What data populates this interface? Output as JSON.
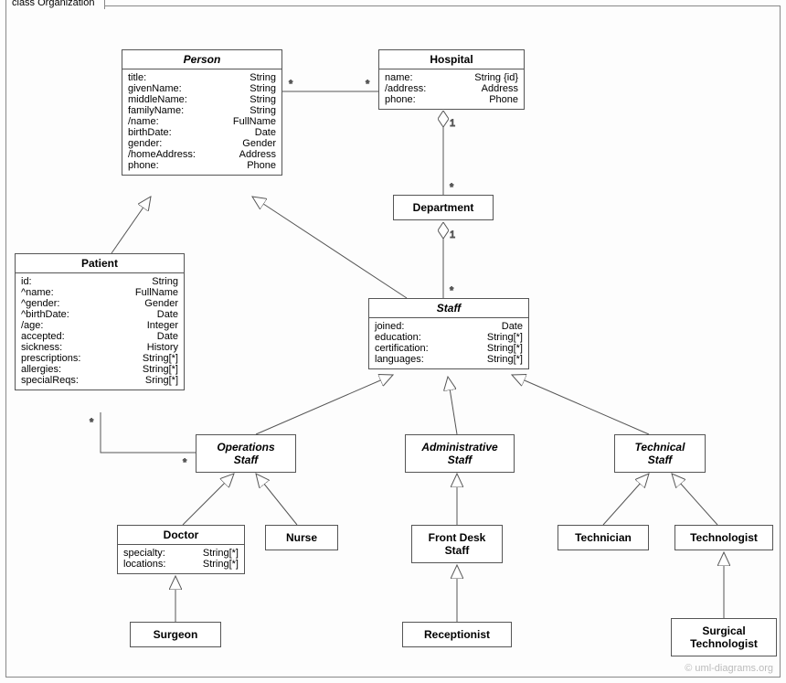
{
  "frame": {
    "label": "class Organization"
  },
  "classes": {
    "person": {
      "name": "Person",
      "attrs": [
        [
          "title:",
          "String"
        ],
        [
          "givenName:",
          "String"
        ],
        [
          "middleName:",
          "String"
        ],
        [
          "familyName:",
          "String"
        ],
        [
          "/name:",
          "FullName"
        ],
        [
          "birthDate:",
          "Date"
        ],
        [
          "gender:",
          "Gender"
        ],
        [
          "/homeAddress:",
          "Address"
        ],
        [
          "phone:",
          "Phone"
        ]
      ]
    },
    "hospital": {
      "name": "Hospital",
      "attrs": [
        [
          "name:",
          "String {id}"
        ],
        [
          "/address:",
          "Address"
        ],
        [
          "phone:",
          "Phone"
        ]
      ]
    },
    "department": {
      "name": "Department"
    },
    "patient": {
      "name": "Patient",
      "attrs": [
        [
          "id:",
          "String"
        ],
        [
          "^name:",
          "FullName"
        ],
        [
          "^gender:",
          "Gender"
        ],
        [
          "^birthDate:",
          "Date"
        ],
        [
          "/age:",
          "Integer"
        ],
        [
          "accepted:",
          "Date"
        ],
        [
          "sickness:",
          "History"
        ],
        [
          "prescriptions:",
          "String[*]"
        ],
        [
          "allergies:",
          "String[*]"
        ],
        [
          "specialReqs:",
          "Sring[*]"
        ]
      ]
    },
    "staff": {
      "name": "Staff",
      "attrs": [
        [
          "joined:",
          "Date"
        ],
        [
          "education:",
          "String[*]"
        ],
        [
          "certification:",
          "String[*]"
        ],
        [
          "languages:",
          "String[*]"
        ]
      ]
    },
    "opsStaff": {
      "name": "Operations\nStaff"
    },
    "adminStaff": {
      "name": "Administrative\nStaff"
    },
    "techStaff": {
      "name": "Technical\nStaff"
    },
    "doctor": {
      "name": "Doctor",
      "attrs": [
        [
          "specialty:",
          "String[*]"
        ],
        [
          "locations:",
          "String[*]"
        ]
      ]
    },
    "nurse": {
      "name": "Nurse"
    },
    "frontDesk": {
      "name": "Front Desk\nStaff"
    },
    "technician": {
      "name": "Technician"
    },
    "technologist": {
      "name": "Technologist"
    },
    "surgeon": {
      "name": "Surgeon"
    },
    "receptionist": {
      "name": "Receptionist"
    },
    "surgTech": {
      "name": "Surgical\nTechnologist"
    }
  },
  "mult": {
    "star": "*",
    "one": "1"
  },
  "watermark": "© uml-diagrams.org"
}
